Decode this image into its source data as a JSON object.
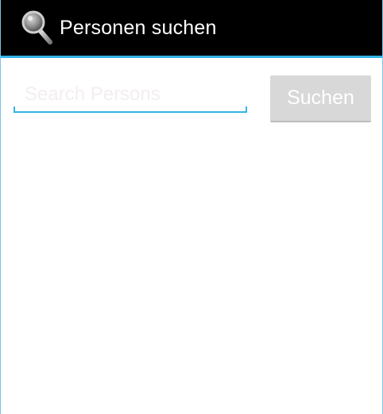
{
  "action_bar": {
    "title": "Personen suchen",
    "icon": "magnifier-icon",
    "background": "#000000",
    "divider_color": "#33b5e5"
  },
  "search": {
    "placeholder": "Search Persons",
    "value": "",
    "button_label": "Suchen"
  },
  "colors": {
    "accent": "#33b5e5",
    "button_background": "#d8d8d8",
    "button_text": "#ffffff"
  }
}
